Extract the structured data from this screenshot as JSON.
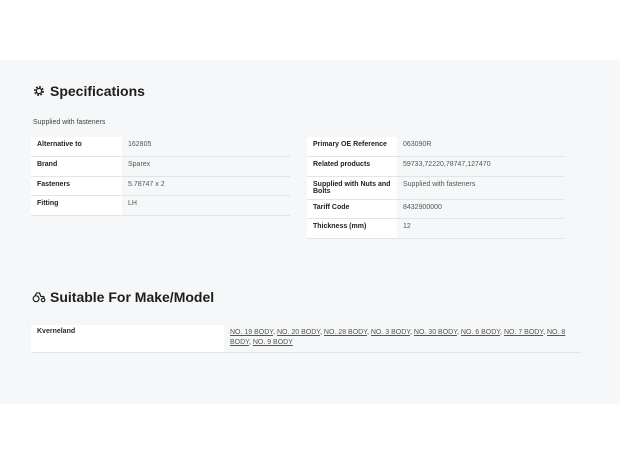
{
  "specifications": {
    "title": "Specifications",
    "intro": "Supplied with fasteners",
    "left_rows": [
      {
        "label": "Alternative to",
        "value": "162805"
      },
      {
        "label": "Brand",
        "value": "Sparex"
      },
      {
        "label": "Fasteners",
        "value": "5.78747 x 2"
      },
      {
        "label": "Fitting",
        "value": "LH"
      }
    ],
    "right_rows": [
      {
        "label": "Primary OE Reference",
        "value": "063090R"
      },
      {
        "label": "Related products",
        "value": "59733,72220,78747,127470"
      },
      {
        "label": "Supplied with Nuts and Bolts",
        "value": "Supplied with fasteners"
      },
      {
        "label": "Tariff Code",
        "value": "8432900000"
      },
      {
        "label": "Thickness (mm)",
        "value": "12"
      }
    ]
  },
  "suitable": {
    "title": "Suitable For Make/Model",
    "make": "Kverneland",
    "models": [
      "NO. 19 BODY",
      "NO. 20 BODY",
      "NO. 28 BODY",
      "NO. 3 BODY",
      "NO. 30 BODY",
      "NO. 6 BODY",
      "NO. 7 BODY",
      "NO. 8 BODY",
      "NO. 9 BODY"
    ]
  },
  "icons": {
    "specifications": "gear-icon",
    "suitable": "tractor-icon"
  }
}
